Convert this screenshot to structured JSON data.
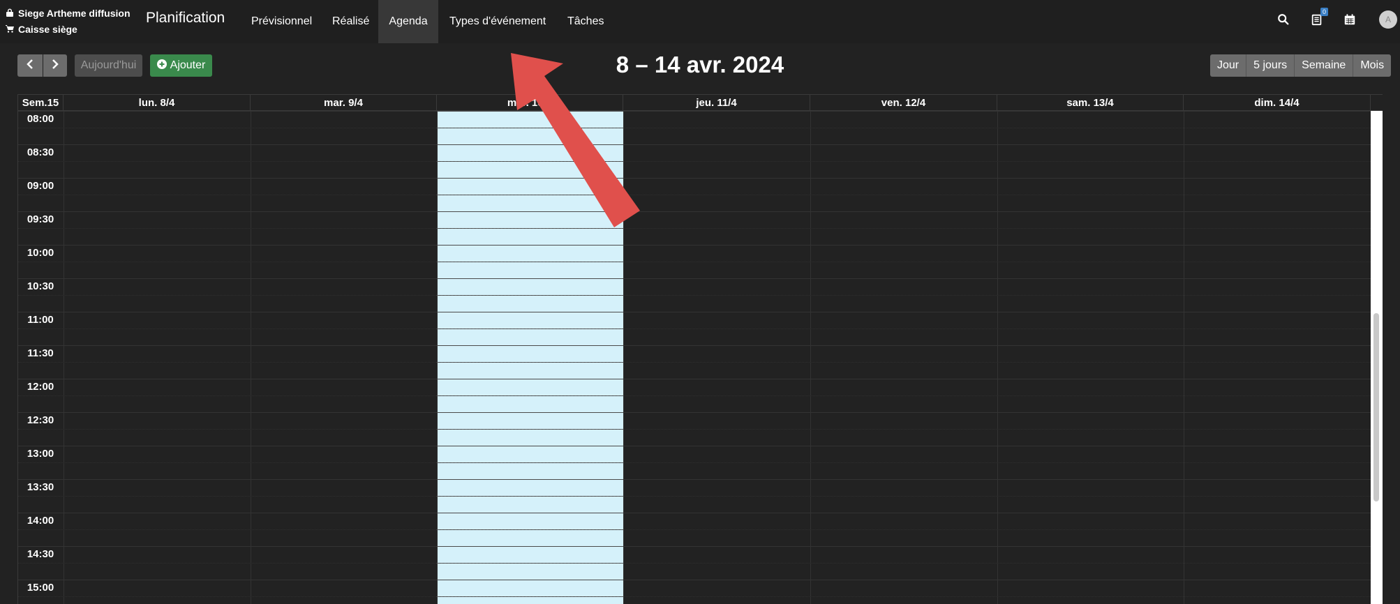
{
  "header": {
    "location": "Siege Artheme diffusion",
    "register": "Caisse siège",
    "brand": "Planification",
    "nav": [
      {
        "label": "Prévisionnel",
        "active": false
      },
      {
        "label": "Réalisé",
        "active": false
      },
      {
        "label": "Agenda",
        "active": true
      },
      {
        "label": "Types d'événement",
        "active": false
      },
      {
        "label": "Tâches",
        "active": false
      }
    ],
    "icons": [
      "search-icon",
      "clipboard-icon",
      "calendar-icon"
    ],
    "notification_count": "0",
    "avatar_initial": "A"
  },
  "toolbar": {
    "today_label": "Aujourd'hui",
    "add_label": "Ajouter",
    "title": "8 – 14 avr. 2024",
    "views": [
      "Jour",
      "5 jours",
      "Semaine",
      "Mois"
    ]
  },
  "calendar": {
    "week_label": "Sem.15",
    "days": [
      "lun. 8/4",
      "mar. 9/4",
      "mer. 10/4",
      "jeu. 11/4",
      "ven. 12/4",
      "sam. 13/4",
      "dim. 14/4"
    ],
    "highlighted_day_index": 2,
    "times": [
      "08:00",
      "08:30",
      "09:00",
      "09:30",
      "10:00",
      "10:30",
      "11:00",
      "11:30",
      "12:00",
      "12:30",
      "13:00",
      "13:30",
      "14:00",
      "14:30",
      "15:00"
    ]
  },
  "colors": {
    "background": "#222222",
    "today_highlight": "#d5f1fa",
    "add_button": "#3a8a4c",
    "annotation_arrow": "#e0504c"
  }
}
